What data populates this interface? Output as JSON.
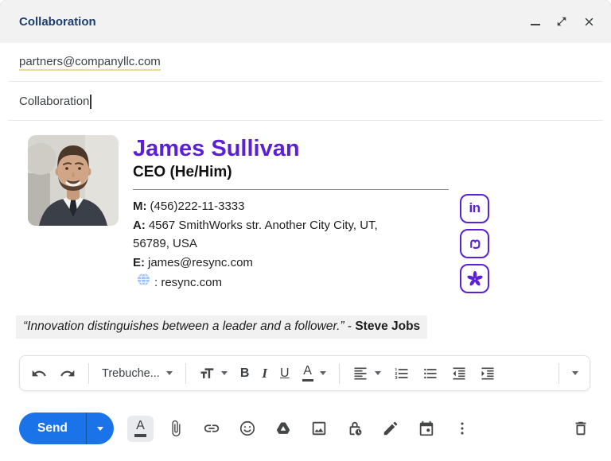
{
  "window": {
    "title": "Collaboration",
    "controls": {
      "minimize": "minimize",
      "pop_out": "open-in-full",
      "close": "close"
    }
  },
  "compose": {
    "recipient": "partners@companyllc.com",
    "subject": "Collaboration"
  },
  "signature": {
    "name": "James Sullivan",
    "role": "CEO (He/Him)",
    "contacts": [
      {
        "label": "M:",
        "value": "(456)222-11-3333"
      },
      {
        "label": "A:",
        "value": "4567 SmithWorks str. Another City City, UT, 56789, USA"
      },
      {
        "label": "E:",
        "value": "james@resync.com"
      },
      {
        "label": "",
        "value": ": resync.com",
        "icon": "globe"
      }
    ],
    "social_icons": [
      "linkedin",
      "mastodon",
      "yelp"
    ],
    "accent_color": "#5B21D9"
  },
  "quote": {
    "text": "“Innovation distinguishes between a leader and a follower.”",
    "separator": " - ",
    "author": "Steve Jobs"
  },
  "format_toolbar": {
    "font_name": "Trebuche...",
    "bold_label": "B",
    "italic_label": "I",
    "underline_label": "U",
    "text_color_label": "A"
  },
  "action_bar": {
    "send_label": "Send",
    "formatting_label": "A",
    "colors": {
      "send_button": "#1A73E8"
    }
  }
}
